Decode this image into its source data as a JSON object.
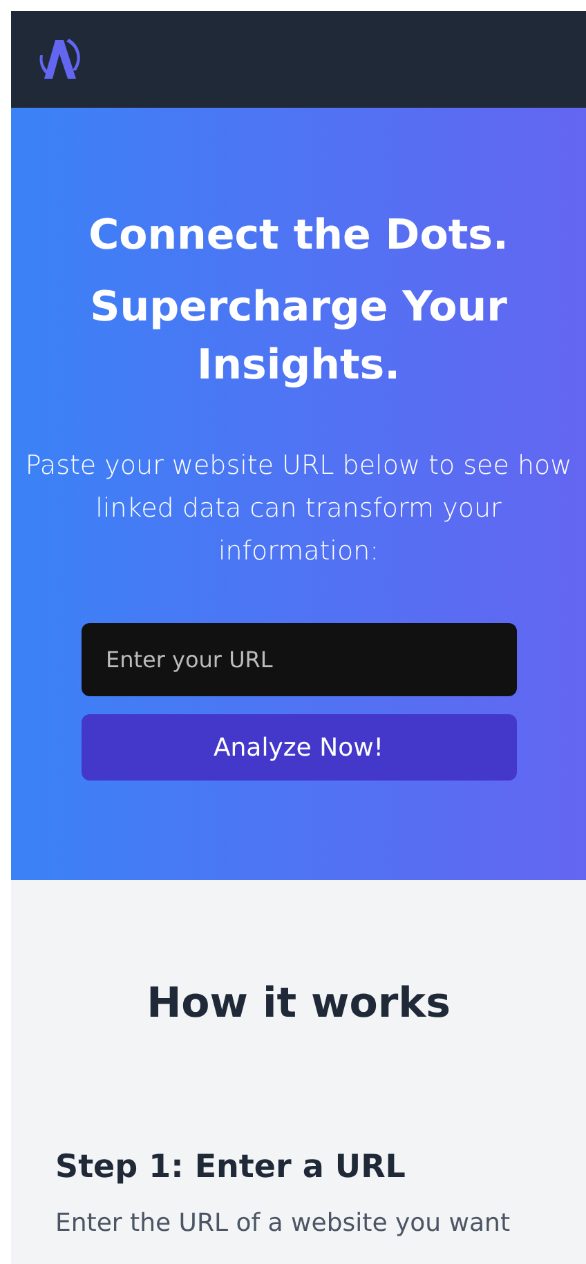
{
  "hero": {
    "title_lines": [
      "Connect the Dots.",
      "Supercharge Your Insights."
    ],
    "subtitle": "Paste your website URL below to see how linked data can transform your information:",
    "url_field": {
      "placeholder": "Enter your URL"
    },
    "button": "Analyze Now!"
  },
  "how_it_works": {
    "title": "How it works",
    "steps": [
      {
        "title": "Step 1: Enter a URL",
        "text": "Enter the URL of a website you want"
      }
    ]
  }
}
